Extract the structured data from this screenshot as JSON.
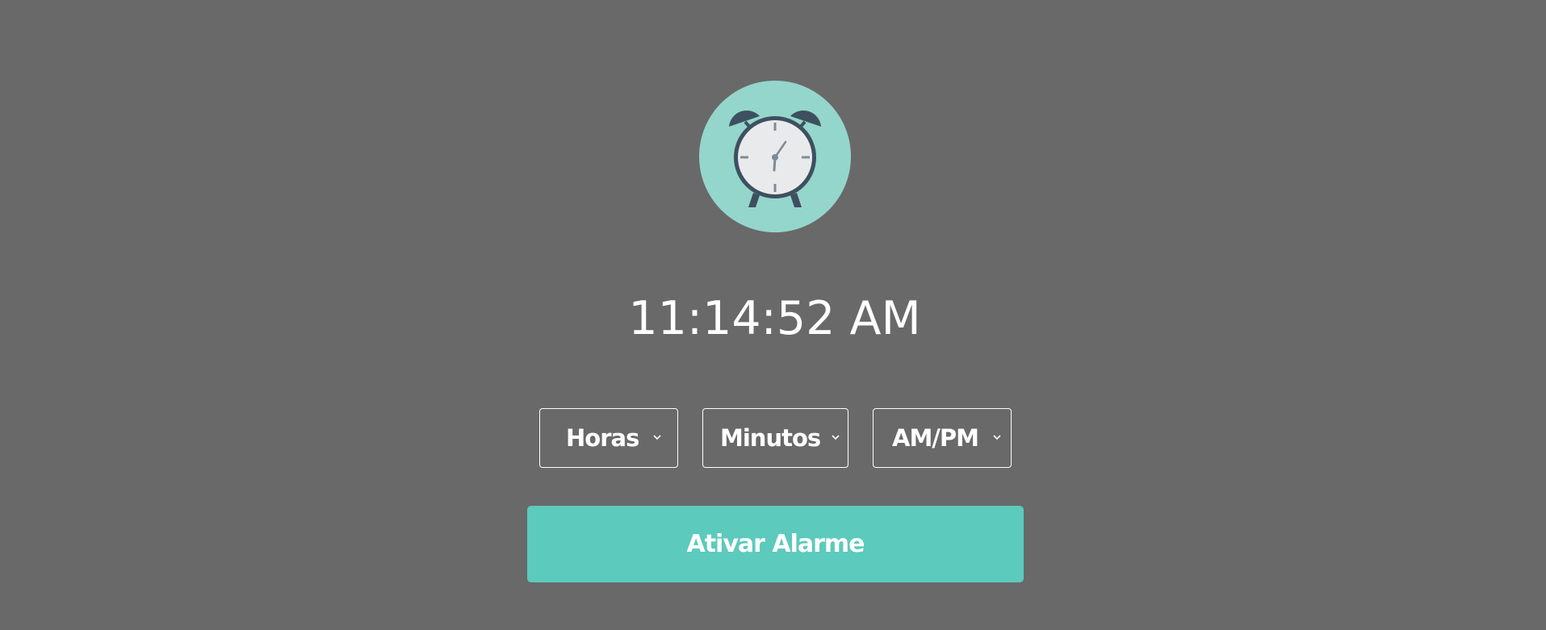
{
  "clock": {
    "time": "11:14:52 AM"
  },
  "selects": {
    "hours": {
      "selected": "Horas"
    },
    "minutes": {
      "selected": "Minutos"
    },
    "ampm": {
      "selected": "AM/PM"
    }
  },
  "actions": {
    "activate_label": "Ativar Alarme"
  },
  "colors": {
    "background": "#696969",
    "accent": "#5ccabc",
    "icon_circle": "#94d6cb",
    "icon_dark": "#3e5060",
    "clock_face": "#e9eaec"
  },
  "icons": {
    "hero": "alarm-clock-icon",
    "dropdown": "chevron-down-icon"
  }
}
